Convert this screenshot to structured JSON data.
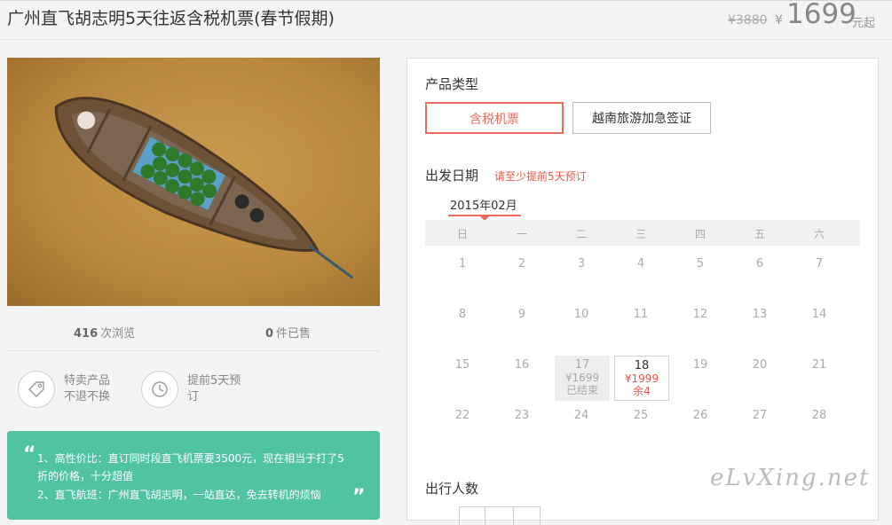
{
  "header": {
    "title": "广州直飞胡志明5天往返含税机票(春节假期)",
    "original_price": "¥3880",
    "currency": "¥",
    "current_price": "1699",
    "price_suffix": "元起"
  },
  "stats": {
    "views_count": "416",
    "views_label": "次浏览",
    "sold_count": "0",
    "sold_label": "件已售"
  },
  "features": [
    {
      "icon": "tag-icon",
      "text": "特卖产品不退不换"
    },
    {
      "icon": "clock-icon",
      "text": "提前5天预订"
    }
  ],
  "promo": {
    "line1": "1、高性价比：直订同时段直飞机票要3500元，现在相当于打了5",
    "line2": "折的价格，十分超值",
    "line3": "2、直飞航班：广州直飞胡志明，一站直达，免去转机的烦恼"
  },
  "booking": {
    "product_type_label": "产品类型",
    "options": [
      {
        "label": "含税机票",
        "selected": true
      },
      {
        "label": "越南旅游加急签证",
        "selected": false
      }
    ],
    "date_label": "出发日期",
    "date_hint": "请至少提前5天预订",
    "month": "2015年02月",
    "weekdays": [
      "日",
      "一",
      "二",
      "三",
      "四",
      "五",
      "六"
    ],
    "weeks": [
      [
        "1",
        "2",
        "3",
        "4",
        "5",
        "6",
        "7"
      ],
      [
        "8",
        "9",
        "10",
        "11",
        "12",
        "13",
        "14"
      ],
      [
        "15",
        "16",
        "17",
        "18",
        "19",
        "20",
        "21"
      ],
      [
        "22",
        "23",
        "24",
        "25",
        "26",
        "27",
        "28"
      ]
    ],
    "special_days": {
      "d17": {
        "day": "17",
        "price": "¥1699",
        "status": "已结束"
      },
      "d18": {
        "day": "18",
        "price": "¥1999",
        "status": "余4"
      }
    },
    "passengers_label": "出行人数"
  },
  "watermark": "eLvXing.net",
  "colors": {
    "accent": "#ea6b5e",
    "promo_bg": "#4fc3a2",
    "hint": "#e8584a"
  }
}
